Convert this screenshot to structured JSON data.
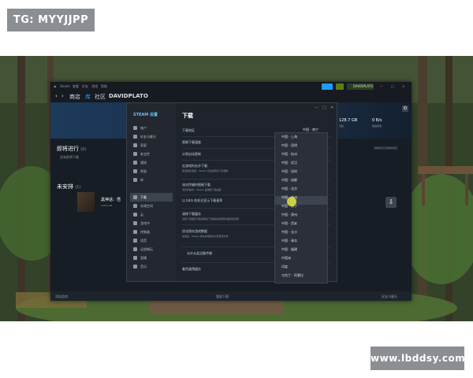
{
  "watermarks": {
    "top_left": "TG: MYYJJPP",
    "bottom_right": "www.lbddsy.com"
  },
  "steam": {
    "titlebar": {
      "app": "Steam",
      "menus": [
        "查看",
        "好友",
        "游戏",
        "帮助"
      ],
      "username": "DAVIDPLATO"
    },
    "nav": {
      "store": "商店",
      "library": "库",
      "community": "社区",
      "username": "DAVIDPLATO"
    },
    "stats": {
      "speed": "128.7 GB",
      "speed_label": "当前",
      "disk": "0 B/s",
      "disk_label": "磁盘使用"
    },
    "sections": {
      "upcoming_label": "即将进行",
      "upcoming_count": "(0)",
      "upcoming_empty": "没有即将下载",
      "unscheduled_label": "未安排",
      "unscheduled_count": "(1)",
      "game_title": "黑神话：悟",
      "game_size": "128.6 GB",
      "clear_label": "清除所有已完成的项目"
    },
    "bottom": {
      "left": "添加游戏",
      "center": "管理下载",
      "right": "好友与聊天"
    }
  },
  "settings": {
    "title": "STEAM 设置",
    "heading": "下载",
    "sidebar": [
      {
        "label": "账户",
        "icon": "account-icon"
      },
      {
        "label": "好友与聊天",
        "icon": "friends-icon"
      },
      {
        "label": "家庭",
        "icon": "family-icon"
      },
      {
        "label": "安全性",
        "icon": "security-icon"
      },
      {
        "label": "通知",
        "icon": "notification-icon"
      },
      {
        "label": "界面",
        "icon": "interface-icon"
      },
      {
        "label": "库",
        "icon": "library-icon"
      },
      {
        "label": "下载",
        "icon": "download-icon"
      },
      {
        "label": "存储空间",
        "icon": "storage-icon"
      },
      {
        "label": "云",
        "icon": "cloud-icon"
      },
      {
        "label": "游戏中",
        "icon": "ingame-icon"
      },
      {
        "label": "控制器",
        "icon": "controller-icon"
      },
      {
        "label": "语音",
        "icon": "voice-icon"
      },
      {
        "label": "远程畅玩",
        "icon": "remoteplay-icon"
      },
      {
        "label": "直播",
        "icon": "broadcast-icon"
      },
      {
        "label": "音乐",
        "icon": "music-icon"
      }
    ],
    "rows": [
      {
        "title": "下载地区",
        "desc": ""
      },
      {
        "title": "限制下载速度",
        "desc": ""
      },
      {
        "title": "计划自动更新",
        "desc": ""
      },
      {
        "title": "在游戏时允许下载",
        "desc": "若选择此选项，Steam 可在游戏时下载更新"
      },
      {
        "title": "流式传输时限制下载",
        "desc": "流式传输时，Steam 会限制下载速度"
      },
      {
        "title": "以 bit/s 的形式显示下载速率",
        "desc": ""
      },
      {
        "title": "清除下载缓存",
        "desc": "清除下载缓存可能会解决下载或启动游戏时遇到的问题"
      },
      {
        "title": "优化保存游戏数据",
        "desc": "启用后，Steam 将在本地预先分配游戏文件"
      },
      {
        "title": "允许从此设备传输",
        "desc": ""
      },
      {
        "title": "着色器预缓存",
        "desc": ""
      }
    ],
    "region_selected": "中国 - 南宁"
  },
  "region_dropdown": [
    "中国 - 上海",
    "中国 - 昆明",
    "中国 - 杭州",
    "中国 - 武汉",
    "中国 - 深圳",
    "中国 - 成都",
    "中国 - 北京",
    "中国 - 苏州",
    "中国 - 南宁",
    "中国 - 郑州",
    "中国 - 西安",
    "中国 - 长沙",
    "中国 - 青岛",
    "中国 - 福建",
    "中国洲",
    "印度",
    "乌克兰 - 阿塞拉"
  ]
}
